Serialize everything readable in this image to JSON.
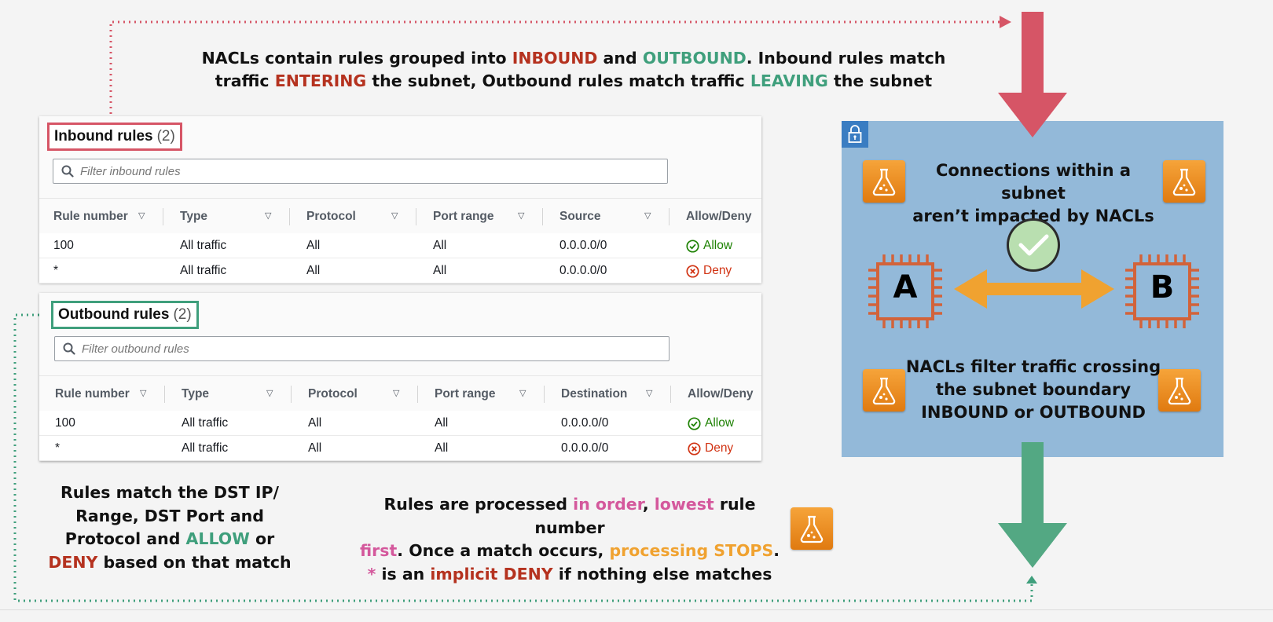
{
  "header_text": {
    "l1_a": "NACLs contain rules grouped into ",
    "l1_inbound": "INBOUND",
    "l1_b": " and ",
    "l1_outbound": "OUTBOUND",
    "l1_c": ". Inbound rules match",
    "l2_a": "traffic ",
    "l2_entering": "ENTERING",
    "l2_b": " the subnet, Outbound rules match traffic ",
    "l2_leaving": "LEAVING",
    "l2_c": " the subnet"
  },
  "inbound": {
    "title": "Inbound rules",
    "count": "(2)",
    "search_placeholder": "Filter inbound rules",
    "columns": [
      "Rule number",
      "Type",
      "Protocol",
      "Port range",
      "Source",
      "Allow/Deny"
    ],
    "rows": [
      {
        "rule": "100",
        "type": "All traffic",
        "protocol": "All",
        "port": "All",
        "addr": "0.0.0.0/0",
        "action": "Allow"
      },
      {
        "rule": "*",
        "type": "All traffic",
        "protocol": "All",
        "port": "All",
        "addr": "0.0.0.0/0",
        "action": "Deny"
      }
    ]
  },
  "outbound": {
    "title": "Outbound rules",
    "count": "(2)",
    "search_placeholder": "Filter outbound rules",
    "columns": [
      "Rule number",
      "Type",
      "Protocol",
      "Port range",
      "Destination",
      "Allow/Deny"
    ],
    "rows": [
      {
        "rule": "100",
        "type": "All traffic",
        "protocol": "All",
        "port": "All",
        "addr": "0.0.0.0/0",
        "action": "Allow"
      },
      {
        "rule": "*",
        "type": "All traffic",
        "protocol": "All",
        "port": "All",
        "addr": "0.0.0.0/0",
        "action": "Deny"
      }
    ]
  },
  "diagram": {
    "top_text_l1": "Connections within a subnet",
    "top_text_l2": "aren’t impacted by NACLs",
    "node_a": "A",
    "node_b": "B",
    "bottom_text_l1": "NACLs filter traffic crossing",
    "bottom_text_l2": "the subnet boundary",
    "bottom_text_l3": "INBOUND or OUTBOUND"
  },
  "bottom_left": {
    "l1": "Rules match the DST IP/",
    "l2": "Range, DST Port and",
    "l3a": "Protocol and ",
    "l3_allow": "ALLOW",
    "l3b": " or",
    "l4_deny": "DENY",
    "l4b": " based on that match"
  },
  "bottom_mid": {
    "l1a": "Rules are processed ",
    "l1_inorder": "in order",
    "l1b": ", ",
    "l1_lowest": "lowest",
    "l1c": " rule number",
    "l2_first": "first",
    "l2a": ". Once a match occurs, ",
    "l2_stops": "processing STOPS",
    "l2b": ".",
    "l3_star": "*",
    "l3a": " is an ",
    "l3_implicit": "implicit DENY",
    "l3b": " if nothing else matches"
  },
  "colors": {
    "inbound_accent": "#d65566",
    "outbound_accent": "#3f9f7c",
    "subnet_bg": "#93b9d9",
    "chip": "#d2633a",
    "arrow": "#f0a230"
  },
  "icons": [
    "search-icon",
    "lock-icon",
    "flask-icon",
    "check-circle-icon",
    "x-circle-icon",
    "chip-icon",
    "down-arrow-icon",
    "double-arrow-icon"
  ]
}
